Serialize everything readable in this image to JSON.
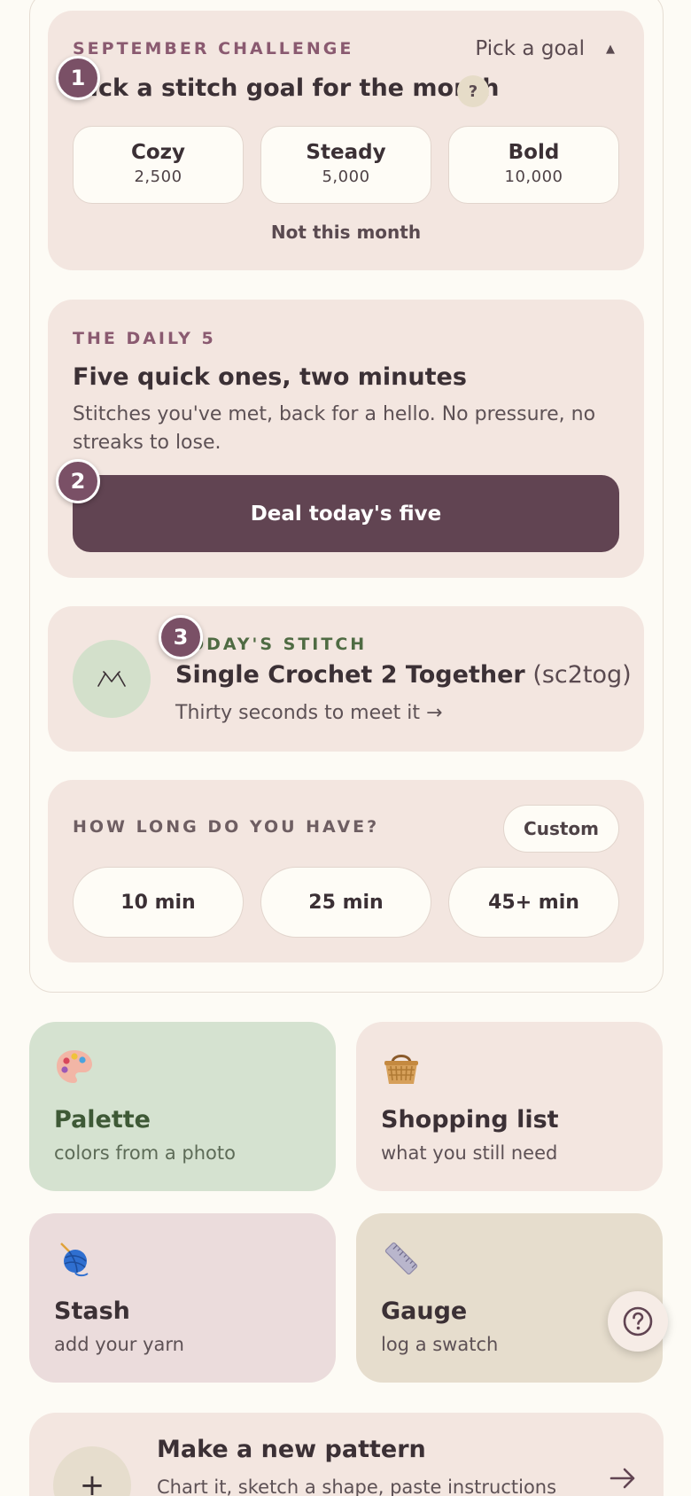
{
  "challenge": {
    "eyebrow": "SEPTEMBER CHALLENGE",
    "pick_goal_label": "Pick a goal",
    "title": "Pick a stitch goal for the month",
    "help_label": "?",
    "options": [
      {
        "name": "Cozy",
        "value": "2,500"
      },
      {
        "name": "Steady",
        "value": "5,000"
      },
      {
        "name": "Bold",
        "value": "10,000"
      }
    ],
    "decline_label": "Not this month"
  },
  "daily": {
    "eyebrow": "THE DAILY 5",
    "title": "Five quick ones, two minutes",
    "description": "Stitches you've met, back for a hello. No pressure, no streaks to lose.",
    "button_label": "Deal today's five"
  },
  "stitch": {
    "eyebrow": "TODAY'S STITCH",
    "name": "Single Crochet 2 Together",
    "abbr": "(sc2tog)",
    "link_label": "Thirty seconds to meet it →"
  },
  "time": {
    "eyebrow": "HOW LONG DO YOU HAVE?",
    "custom_label": "Custom",
    "options": [
      "10 min",
      "25 min",
      "45+ min"
    ]
  },
  "tiles": [
    {
      "title": "Palette",
      "subtitle": "colors from a photo",
      "icon": "palette-icon"
    },
    {
      "title": "Shopping list",
      "subtitle": "what you still need",
      "icon": "basket-icon"
    },
    {
      "title": "Stash",
      "subtitle": "add your yarn",
      "icon": "yarn-ball-icon"
    },
    {
      "title": "Gauge",
      "subtitle": "log a swatch",
      "icon": "ruler-icon"
    }
  ],
  "new_pattern": {
    "title": "Make a new pattern",
    "subtitle": "Chart it, sketch a shape, paste instructions"
  },
  "markers": [
    "1",
    "2",
    "3"
  ],
  "colors": {
    "background": "#fdfbf5",
    "card": "#f3e6e0",
    "primary_button": "#614452",
    "accent_plum": "#8a5a70",
    "accent_green": "#4f6b43",
    "marker": "#7a5066"
  }
}
